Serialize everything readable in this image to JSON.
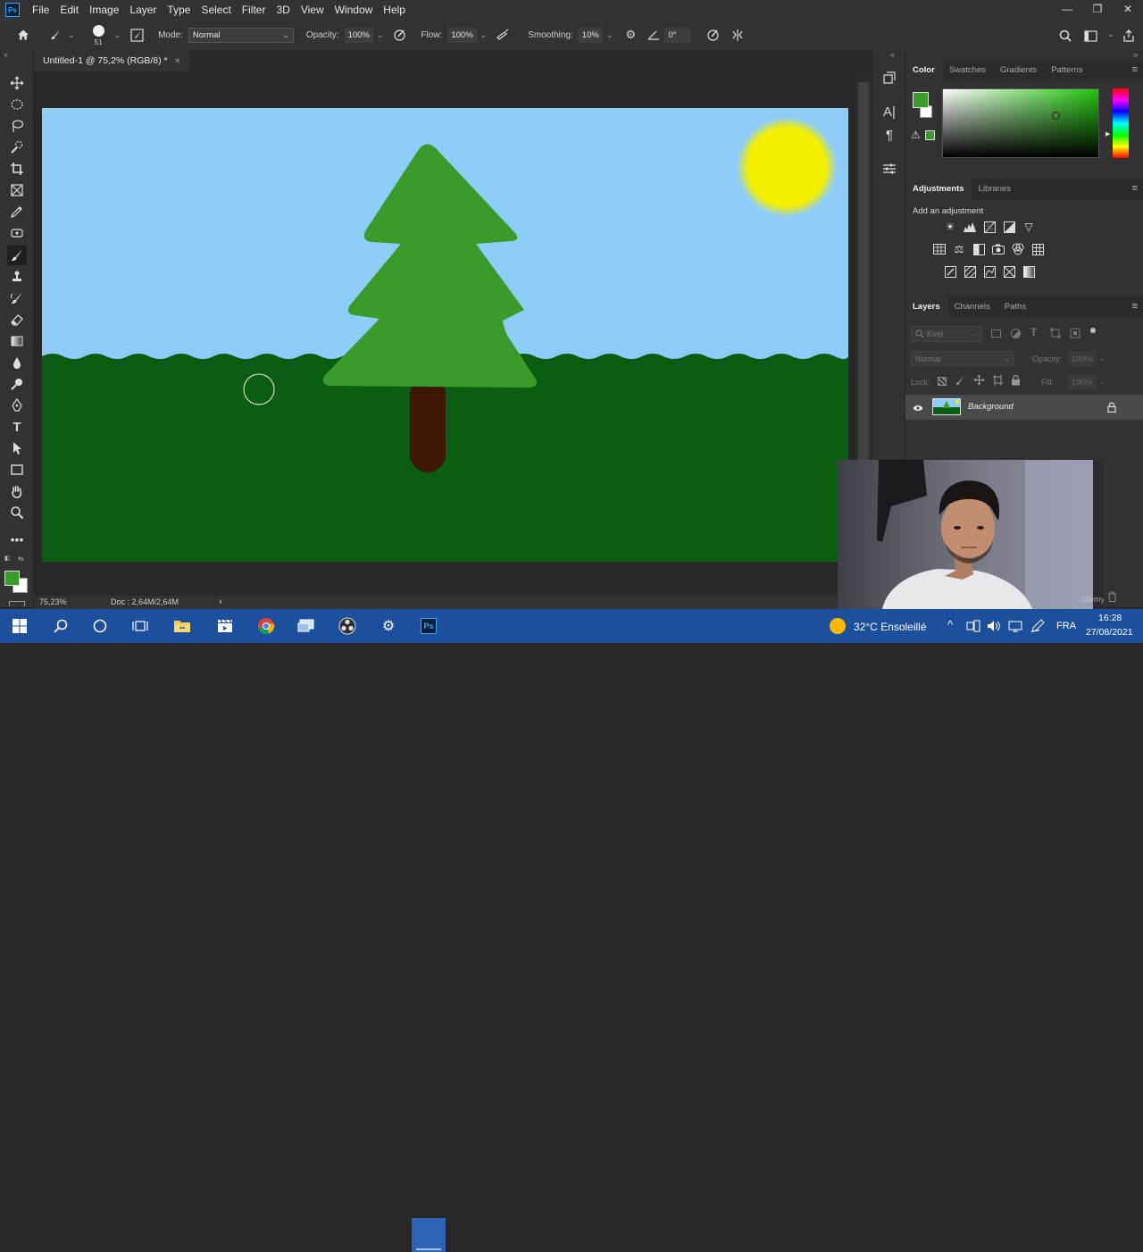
{
  "menubar": {
    "logo": "Ps",
    "items": [
      "File",
      "Edit",
      "Image",
      "Layer",
      "Type",
      "Select",
      "Filter",
      "3D",
      "View",
      "Window",
      "Help"
    ],
    "controls": [
      "—",
      "❐",
      "✕"
    ]
  },
  "options": {
    "brush_size": "51",
    "mode_label": "Mode:",
    "mode_value": "Normal",
    "opacity_label": "Opacity:",
    "opacity_value": "100%",
    "flow_label": "Flow:",
    "flow_value": "100%",
    "smoothing_label": "Smoothing:",
    "smoothing_value": "10%",
    "angle_value": "0°"
  },
  "document": {
    "tab_title": "Untitled-1 @ 75,2% (RGB/8) *",
    "tab_close": "×",
    "colors": {
      "sky": "#8ecdf8",
      "grass": "#0b5d11",
      "tree": "#389b2a",
      "trunk": "#3d1704",
      "sun": "#f4f000"
    }
  },
  "status": {
    "zoom": "75,23%",
    "doc": "Doc : 2,64M/2,64M",
    "arrow": "›"
  },
  "color_panel": {
    "tabs": [
      "Color",
      "Swatches",
      "Gradients",
      "Patterns"
    ],
    "foreground": "#389b2a"
  },
  "adjustments_panel": {
    "tabs": [
      "Adjustments",
      "Libraries"
    ],
    "hint": "Add an adjustment"
  },
  "layers_panel": {
    "tabs": [
      "Layers",
      "Channels",
      "Paths"
    ],
    "filter_placeholder": "Kind",
    "blend_mode": "Normal",
    "opacity_label": "Opacity:",
    "opacity_value": "100%",
    "lock_label": "Lock:",
    "fill_label": "Fill:",
    "fill_value": "100%",
    "layer_name": "Background"
  },
  "taskbar": {
    "weather": "32°C Ensoleillé",
    "language": "FRA",
    "time": "16:28",
    "date": "27/08/2021"
  },
  "webcam": {
    "watermark": "udemy"
  }
}
